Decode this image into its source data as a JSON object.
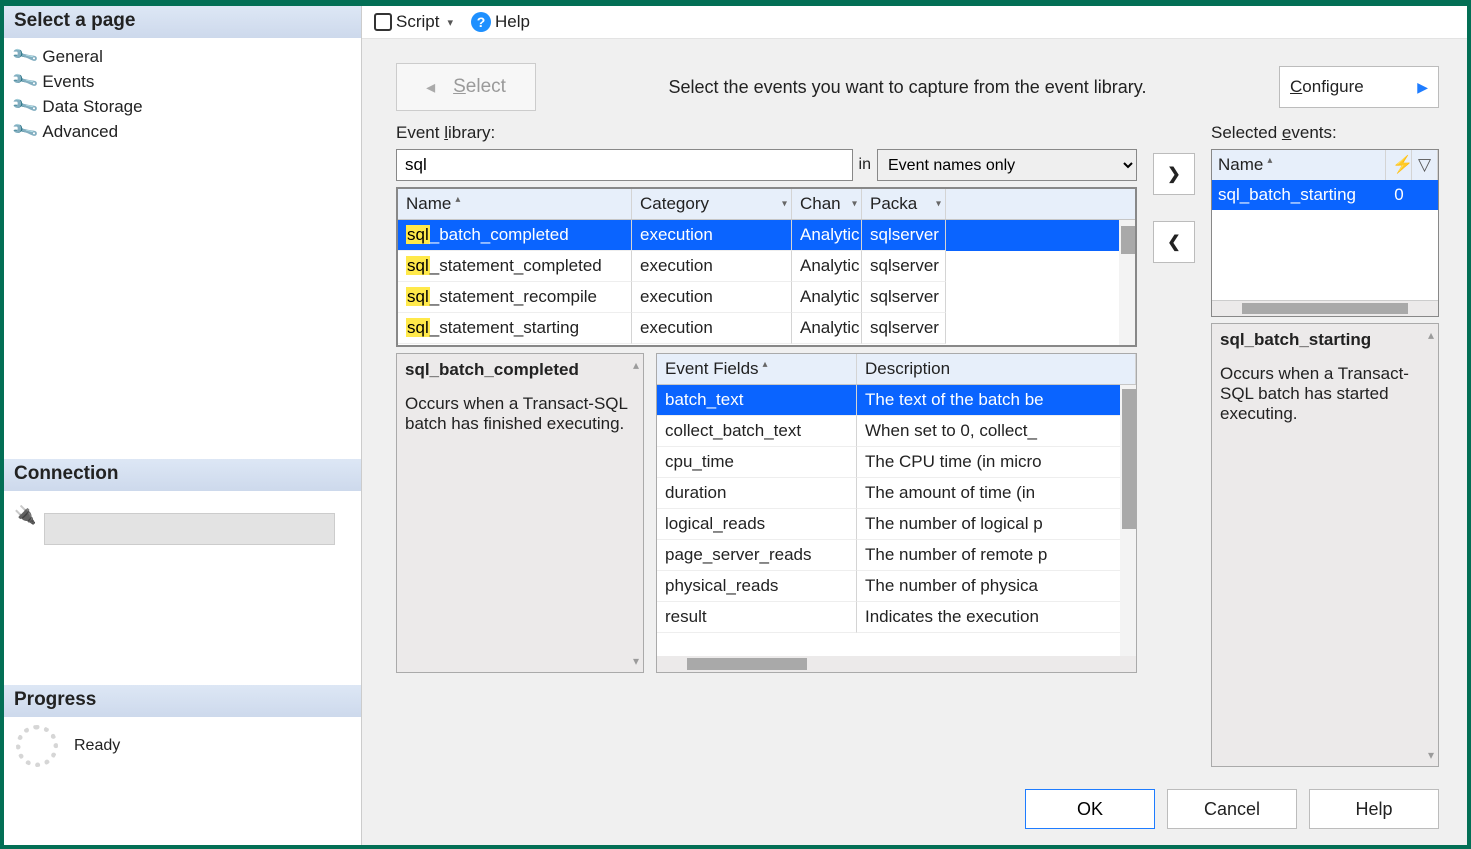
{
  "sidebar": {
    "header": "Select a page",
    "items": [
      {
        "label": "General",
        "selected": false
      },
      {
        "label": "Events",
        "selected": true
      },
      {
        "label": "Data Storage",
        "selected": false
      },
      {
        "label": "Advanced",
        "selected": false
      }
    ],
    "connection_header": "Connection",
    "progress_header": "Progress",
    "progress_status": "Ready"
  },
  "toolbar": {
    "script": "Script",
    "help": "Help"
  },
  "top": {
    "back_caret": "◂",
    "select_label": "Select",
    "instruction": "Select the events you want to capture from the event library.",
    "configure_label": "Configure"
  },
  "library": {
    "label": "Event library:",
    "search_value": "sql",
    "in_label": "in",
    "search_scope": "Event names only",
    "columns": {
      "name": "Name",
      "category": "Category",
      "channel": "Chan",
      "package": "Packa"
    },
    "rows": [
      {
        "hl": "sql",
        "rest": "_batch_completed",
        "category": "execution",
        "channel": "Analytic",
        "package": "sqlserver",
        "selected": true
      },
      {
        "hl": "sql",
        "rest": "_statement_completed",
        "category": "execution",
        "channel": "Analytic",
        "package": "sqlserver",
        "selected": false
      },
      {
        "hl": "sql",
        "rest": "_statement_recompile",
        "category": "execution",
        "channel": "Analytic",
        "package": "sqlserver",
        "selected": false
      },
      {
        "hl": "sql",
        "rest": "_statement_starting",
        "category": "execution",
        "channel": "Analytic",
        "package": "sqlserver",
        "selected": false
      }
    ]
  },
  "event_desc": {
    "title": "sql_batch_completed",
    "body": "Occurs when a Transact-SQL batch has finished executing."
  },
  "fields": {
    "col_field": "Event Fields",
    "col_desc": "Description",
    "rows": [
      {
        "name": "batch_text",
        "desc": "The text of the batch be",
        "selected": true
      },
      {
        "name": "collect_batch_text",
        "desc": "When set to 0, collect_",
        "selected": false
      },
      {
        "name": "cpu_time",
        "desc": "The CPU time (in micro",
        "selected": false
      },
      {
        "name": "duration",
        "desc": "The amount of time (in ",
        "selected": false
      },
      {
        "name": "logical_reads",
        "desc": "The number of logical p",
        "selected": false
      },
      {
        "name": "page_server_reads",
        "desc": "The number of remote p",
        "selected": false
      },
      {
        "name": "physical_reads",
        "desc": "The number of physica",
        "selected": false
      },
      {
        "name": "result",
        "desc": "Indicates the execution",
        "selected": false
      }
    ]
  },
  "selected": {
    "label": "Selected events:",
    "col_name": "Name",
    "rows": [
      {
        "name": "sql_batch_starting",
        "count": "0"
      }
    ],
    "desc_title": "sql_batch_starting",
    "desc_body": "Occurs when a Transact-SQL batch has started executing."
  },
  "footer": {
    "ok": "OK",
    "cancel": "Cancel",
    "help": "Help"
  }
}
